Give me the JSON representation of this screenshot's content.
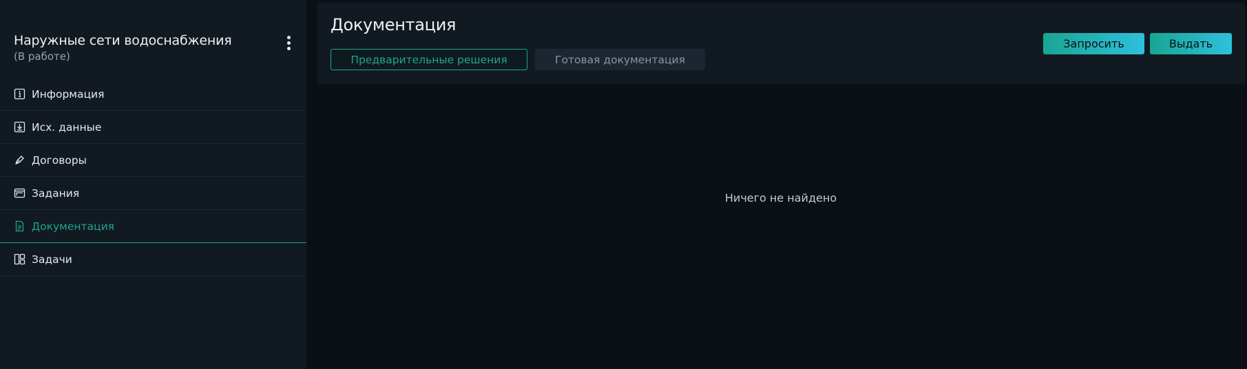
{
  "sidebar": {
    "project_title": "Наружные сети водоснабжения",
    "project_status": "(В работе)",
    "items": [
      {
        "label": "Информация",
        "icon": "info-icon"
      },
      {
        "label": "Исх. данные",
        "icon": "download-icon"
      },
      {
        "label": "Договоры",
        "icon": "pen-icon"
      },
      {
        "label": "Задания",
        "icon": "windows-icon"
      },
      {
        "label": "Документация",
        "icon": "document-icon",
        "active": true
      },
      {
        "label": "Задачи",
        "icon": "layout-icon"
      }
    ]
  },
  "main": {
    "title": "Документация",
    "tabs": [
      {
        "label": "Предварительные решения",
        "active": true
      },
      {
        "label": "Готовая документация",
        "active": false
      }
    ],
    "buttons": {
      "request": "Запросить",
      "issue": "Выдать"
    },
    "empty_message": "Ничего не найдено"
  },
  "colors": {
    "accent": "#1fa58f",
    "background": "#0b1017",
    "panel": "#121a21"
  }
}
